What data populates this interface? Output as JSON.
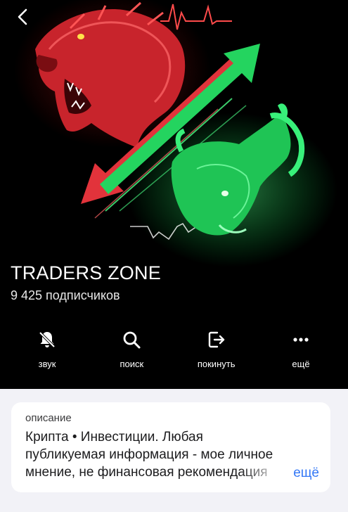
{
  "channel": {
    "name": "TRADERS ZONE",
    "subscribers": "9 425 подписчиков"
  },
  "actions": [
    {
      "label": "звук",
      "icon": "bell-slash-icon"
    },
    {
      "label": "поиск",
      "icon": "search-icon"
    },
    {
      "label": "покинуть",
      "icon": "leave-icon"
    },
    {
      "label": "ещё",
      "icon": "more-icon"
    }
  ],
  "description": {
    "label": "описание",
    "text": "Крипта • Инвестиции. Любая публикуемая информация - мое личное мнение, не финансовая рекомендация",
    "more": "ещё"
  },
  "colors": {
    "hero_background": "#000000",
    "bear": "#d9343a",
    "bull": "#2ee66b",
    "link": "#3478f6"
  }
}
